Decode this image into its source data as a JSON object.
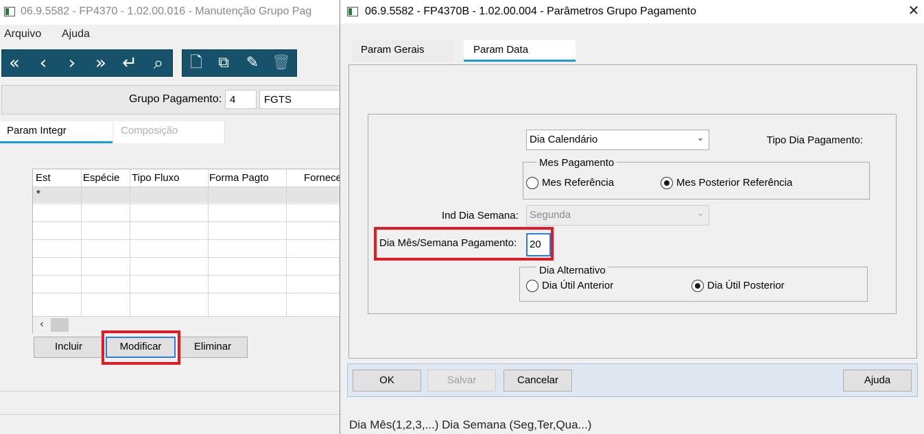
{
  "background_window": {
    "title": "06.9.5582 - FP4370 - 1.02.00.016 - Manutenção Grupo Pag",
    "menu": [
      "Arquivo",
      "Ajuda"
    ],
    "toolbar_nav": [
      {
        "icon": "first-record-icon",
        "glyph": "«"
      },
      {
        "icon": "previous-record-icon",
        "glyph": "‹"
      },
      {
        "icon": "next-record-icon",
        "glyph": "›"
      },
      {
        "icon": "last-record-icon",
        "glyph": "»"
      },
      {
        "icon": "return-icon",
        "glyph": "↵"
      },
      {
        "icon": "search-icon",
        "glyph": "⌕"
      }
    ],
    "toolbar_edit": [
      {
        "icon": "new-document-icon",
        "glyph": "🗋"
      },
      {
        "icon": "copy-icon",
        "glyph": "⧉"
      },
      {
        "icon": "edit-icon",
        "glyph": "✎"
      },
      {
        "icon": "delete-icon",
        "glyph": "🗑"
      }
    ],
    "grupo_pagamento_label": "Grupo Pagamento:",
    "grupo_pagamento_code": "4",
    "grupo_pagamento_desc": "FGTS",
    "tabs": [
      "Param Integr",
      "Composição"
    ],
    "grid": {
      "columns": [
        "Est",
        "Espécie",
        "Tipo Fluxo",
        "Forma Pagto",
        "Fornece"
      ],
      "first_row_marker": "*"
    },
    "buttons": {
      "incluir": "Incluir",
      "modificar": "Modificar",
      "eliminar": "Eliminar"
    }
  },
  "dialog": {
    "title": "06.9.5582 - FP4370B - 1.02.00.004 - Parâmetros Grupo Pagamento",
    "close_glyph": "✕",
    "tabs": [
      "Param Gerais",
      "Param Data"
    ],
    "active_tab": "Param Data",
    "tipo_dia_pagamento_label": "Tipo Dia Pagamento:",
    "tipo_dia_pagamento_value": "Dia Calendário",
    "mes_pagamento": {
      "legend": "Mes Pagamento",
      "options": [
        "Mes Referência",
        "Mes Posterior Referência"
      ],
      "selected": "Mes Posterior Referência"
    },
    "ind_dia_semana_label": "Ind Dia Semana:",
    "ind_dia_semana_value": "Segunda",
    "dia_mes_semana_label": "Dia Mês/Semana Pagamento:",
    "dia_mes_semana_value": "20",
    "dia_alternativo": {
      "legend": "Dia Alternativo",
      "options": [
        "Dia Útil Anterior",
        "Dia Útil Posterior"
      ],
      "selected": "Dia Útil Posterior"
    },
    "buttons": {
      "ok": "OK",
      "salvar": "Salvar",
      "cancelar": "Cancelar",
      "ajuda": "Ajuda"
    },
    "status_text": "Dia Mês(1,2,3,...) Dia Semana (Seg,Ter,Qua...)"
  },
  "colors": {
    "toolbar_bg": "#16536b",
    "tab_accent": "#1a9ad6",
    "highlight_red": "#e21b23",
    "focus_blue": "#2a7be4"
  }
}
